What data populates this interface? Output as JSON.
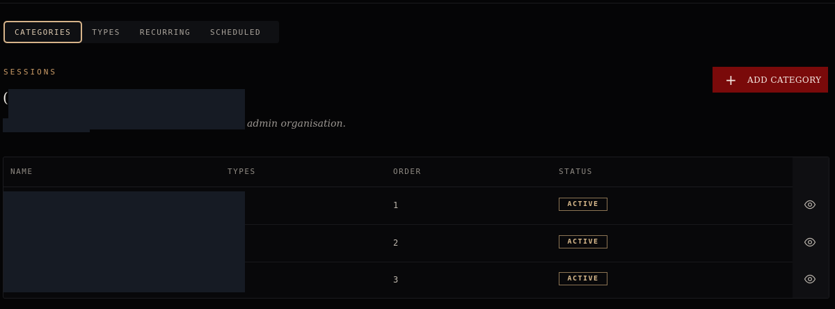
{
  "tabs": [
    {
      "label": "CATEGORIES",
      "active": true
    },
    {
      "label": "TYPES",
      "active": false
    },
    {
      "label": "RECURRING",
      "active": false
    },
    {
      "label": "SCHEDULED",
      "active": false
    }
  ],
  "header": {
    "eyebrow": "SESSIONS",
    "title_visible": "(",
    "subtitle_visible": "admin organisation."
  },
  "actions": {
    "add_icon": "+",
    "add_label": "ADD CATEGORY"
  },
  "table": {
    "columns": [
      "NAME",
      "TYPES",
      "ORDER",
      "STATUS"
    ],
    "rows": [
      {
        "order": "1",
        "status": "ACTIVE"
      },
      {
        "order": "2",
        "status": "ACTIVE"
      },
      {
        "order": "3",
        "status": "ACTIVE"
      }
    ]
  },
  "colors": {
    "accent": "#d7b48a",
    "brand_button": "#7a0a0a",
    "background": "#050506"
  }
}
